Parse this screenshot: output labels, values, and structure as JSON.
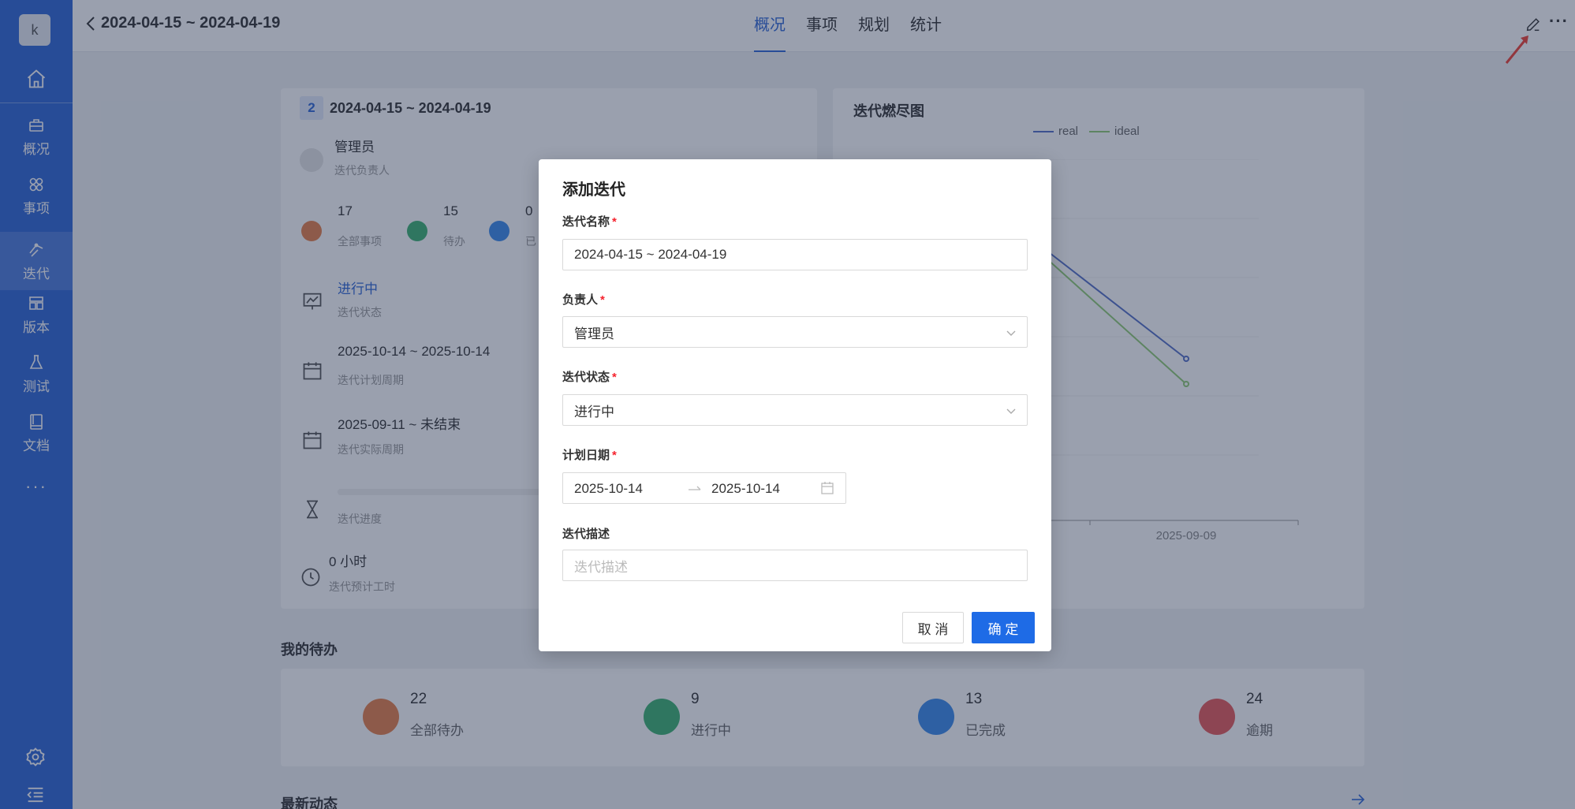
{
  "sidebar": {
    "avatar": "k",
    "items": [
      {
        "label": "概况"
      },
      {
        "label": "事项"
      },
      {
        "label": "迭代"
      },
      {
        "label": "版本"
      },
      {
        "label": "测试"
      },
      {
        "label": "文档"
      }
    ],
    "more": "···"
  },
  "topbar": {
    "title": "2024-04-15 ~ 2024-04-19",
    "tabs": [
      "概况",
      "事项",
      "规划",
      "统计"
    ],
    "more": "···"
  },
  "overview": {
    "badge": "2",
    "title": "2024-04-15 ~ 2024-04-19",
    "owner": "管理员",
    "owner_label": "迭代负责人",
    "stats": [
      {
        "value": "17",
        "label": "全部事项",
        "color": "#e8804a"
      },
      {
        "value": "15",
        "label": "待办",
        "color": "#3cb371"
      },
      {
        "value": "0",
        "label": "已",
        "color": "#3b8beb"
      }
    ],
    "status": "进行中",
    "status_label": "迭代状态",
    "plan_period": "2025-10-14 ~ 2025-10-14",
    "plan_period_label": "迭代计划周期",
    "actual_period": "2025-09-11 ~ 未结束",
    "actual_period_label": "迭代实际周期",
    "progress_label": "迭代进度",
    "hours": "0 小时",
    "hours_label": "迭代预计工时"
  },
  "burndown": {
    "title": "迭代燃尽图",
    "legend": [
      "real",
      "ideal"
    ],
    "colors": {
      "real": "#5470c6",
      "ideal": "#91cc75"
    },
    "x_label": "2025-09-09"
  },
  "todo": {
    "title": "我的待办",
    "items": [
      {
        "value": "22",
        "label": "全部待办",
        "color": "#e8804a"
      },
      {
        "value": "9",
        "label": "进行中",
        "color": "#3cb371"
      },
      {
        "value": "13",
        "label": "已完成",
        "color": "#3b8beb"
      },
      {
        "value": "24",
        "label": "逾期",
        "color": "#e85a5a"
      }
    ]
  },
  "activity": {
    "title": "最新动态"
  },
  "modal": {
    "title": "添加迭代",
    "name_label": "迭代名称",
    "name_value": "2024-04-15 ~ 2024-04-19",
    "owner_label": "负责人",
    "owner_value": "管理员",
    "status_label": "迭代状态",
    "status_value": "进行中",
    "date_label": "计划日期",
    "date_start": "2025-10-14",
    "date_end": "2025-10-14",
    "desc_label": "迭代描述",
    "desc_placeholder": "迭代描述",
    "cancel": "取 消",
    "ok": "确 定",
    "required_mark": "*"
  }
}
